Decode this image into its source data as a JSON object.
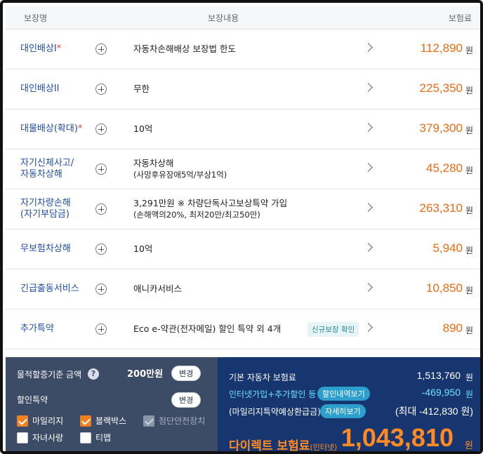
{
  "header": {
    "col_name": "보장명",
    "col_content": "보장내용",
    "col_premium": "보험료"
  },
  "rows": [
    {
      "label": "대인배상I",
      "required": "*",
      "desc": "자동차손해배상 보장법 한도",
      "desc_sub": "",
      "amount": "112,890",
      "unit": "원",
      "badge": ""
    },
    {
      "label": "대인배상II",
      "required": "",
      "desc": "무한",
      "desc_sub": "",
      "amount": "225,350",
      "unit": "원",
      "badge": ""
    },
    {
      "label": "대물배상(확대)",
      "required": "*",
      "desc": "10억",
      "desc_sub": "",
      "amount": "379,300",
      "unit": "원",
      "badge": ""
    },
    {
      "label": "자기신체사고/",
      "label2": "자동차상해",
      "required": "",
      "desc": "자동차상해",
      "desc_sub": "(사망후유장애5억/부상1억)",
      "amount": "45,280",
      "unit": "원",
      "badge": ""
    },
    {
      "label": "자기차량손해",
      "label2": "(자기부담금)",
      "required": "",
      "desc": "3,291만원 ※ 차량단독사고보상특약 가입",
      "desc_sub": "(손해액의20%, 최저20만/최고50만)",
      "amount": "263,310",
      "unit": "원",
      "badge": ""
    },
    {
      "label": "무보험차상해",
      "required": "",
      "desc": "10억",
      "desc_sub": "",
      "amount": "5,940",
      "unit": "원",
      "badge": ""
    },
    {
      "label": "긴급출동서비스",
      "required": "",
      "desc": "애니카서비스",
      "desc_sub": "",
      "amount": "10,850",
      "unit": "원",
      "badge": ""
    },
    {
      "label": "추가특약",
      "required": "",
      "desc": "Eco e-약관(전자메일) 할인 특약 외 4개",
      "desc_sub": "",
      "amount": "890",
      "unit": "원",
      "badge": "신규보장 확인"
    }
  ],
  "left_panel": {
    "property_label": "물적할증기준 금액",
    "property_help": "?",
    "property_value": "200만원",
    "change1": "변경",
    "discount_label": "할인특약",
    "change2": "변경",
    "checkboxes": [
      {
        "label": "마일리지",
        "state": "checked"
      },
      {
        "label": "블랙박스",
        "state": "checked"
      },
      {
        "label": "첨단안전장치",
        "state": "disabled"
      },
      {
        "label": "자녀사랑",
        "state": "unchecked"
      },
      {
        "label": "티맵",
        "state": "unchecked"
      }
    ]
  },
  "right_panel": {
    "base_label": "기본 자동차 보험료",
    "base_value": "1,513,760",
    "base_unit": "원",
    "discount_label": "인터넷가입+추가할인 등",
    "discount_chip": "할인내역보기",
    "discount_value": "-469,950",
    "discount_unit": "원",
    "mileage_label": "(마일리지특약예상환급금)",
    "mileage_chip": "자세히보기",
    "mileage_value": "(최대 -412,830 원)",
    "final_label": "다이렉트 보험료",
    "final_label_small": "(인터넷)",
    "final_value": "1,043,810",
    "final_unit": "원"
  },
  "colors": {
    "accent_orange": "#f26a15",
    "label_blue": "#1f4da8",
    "panel_dark": "#3c4b66",
    "panel_navy": "#17366f",
    "cyan": "#6fe0ff"
  }
}
